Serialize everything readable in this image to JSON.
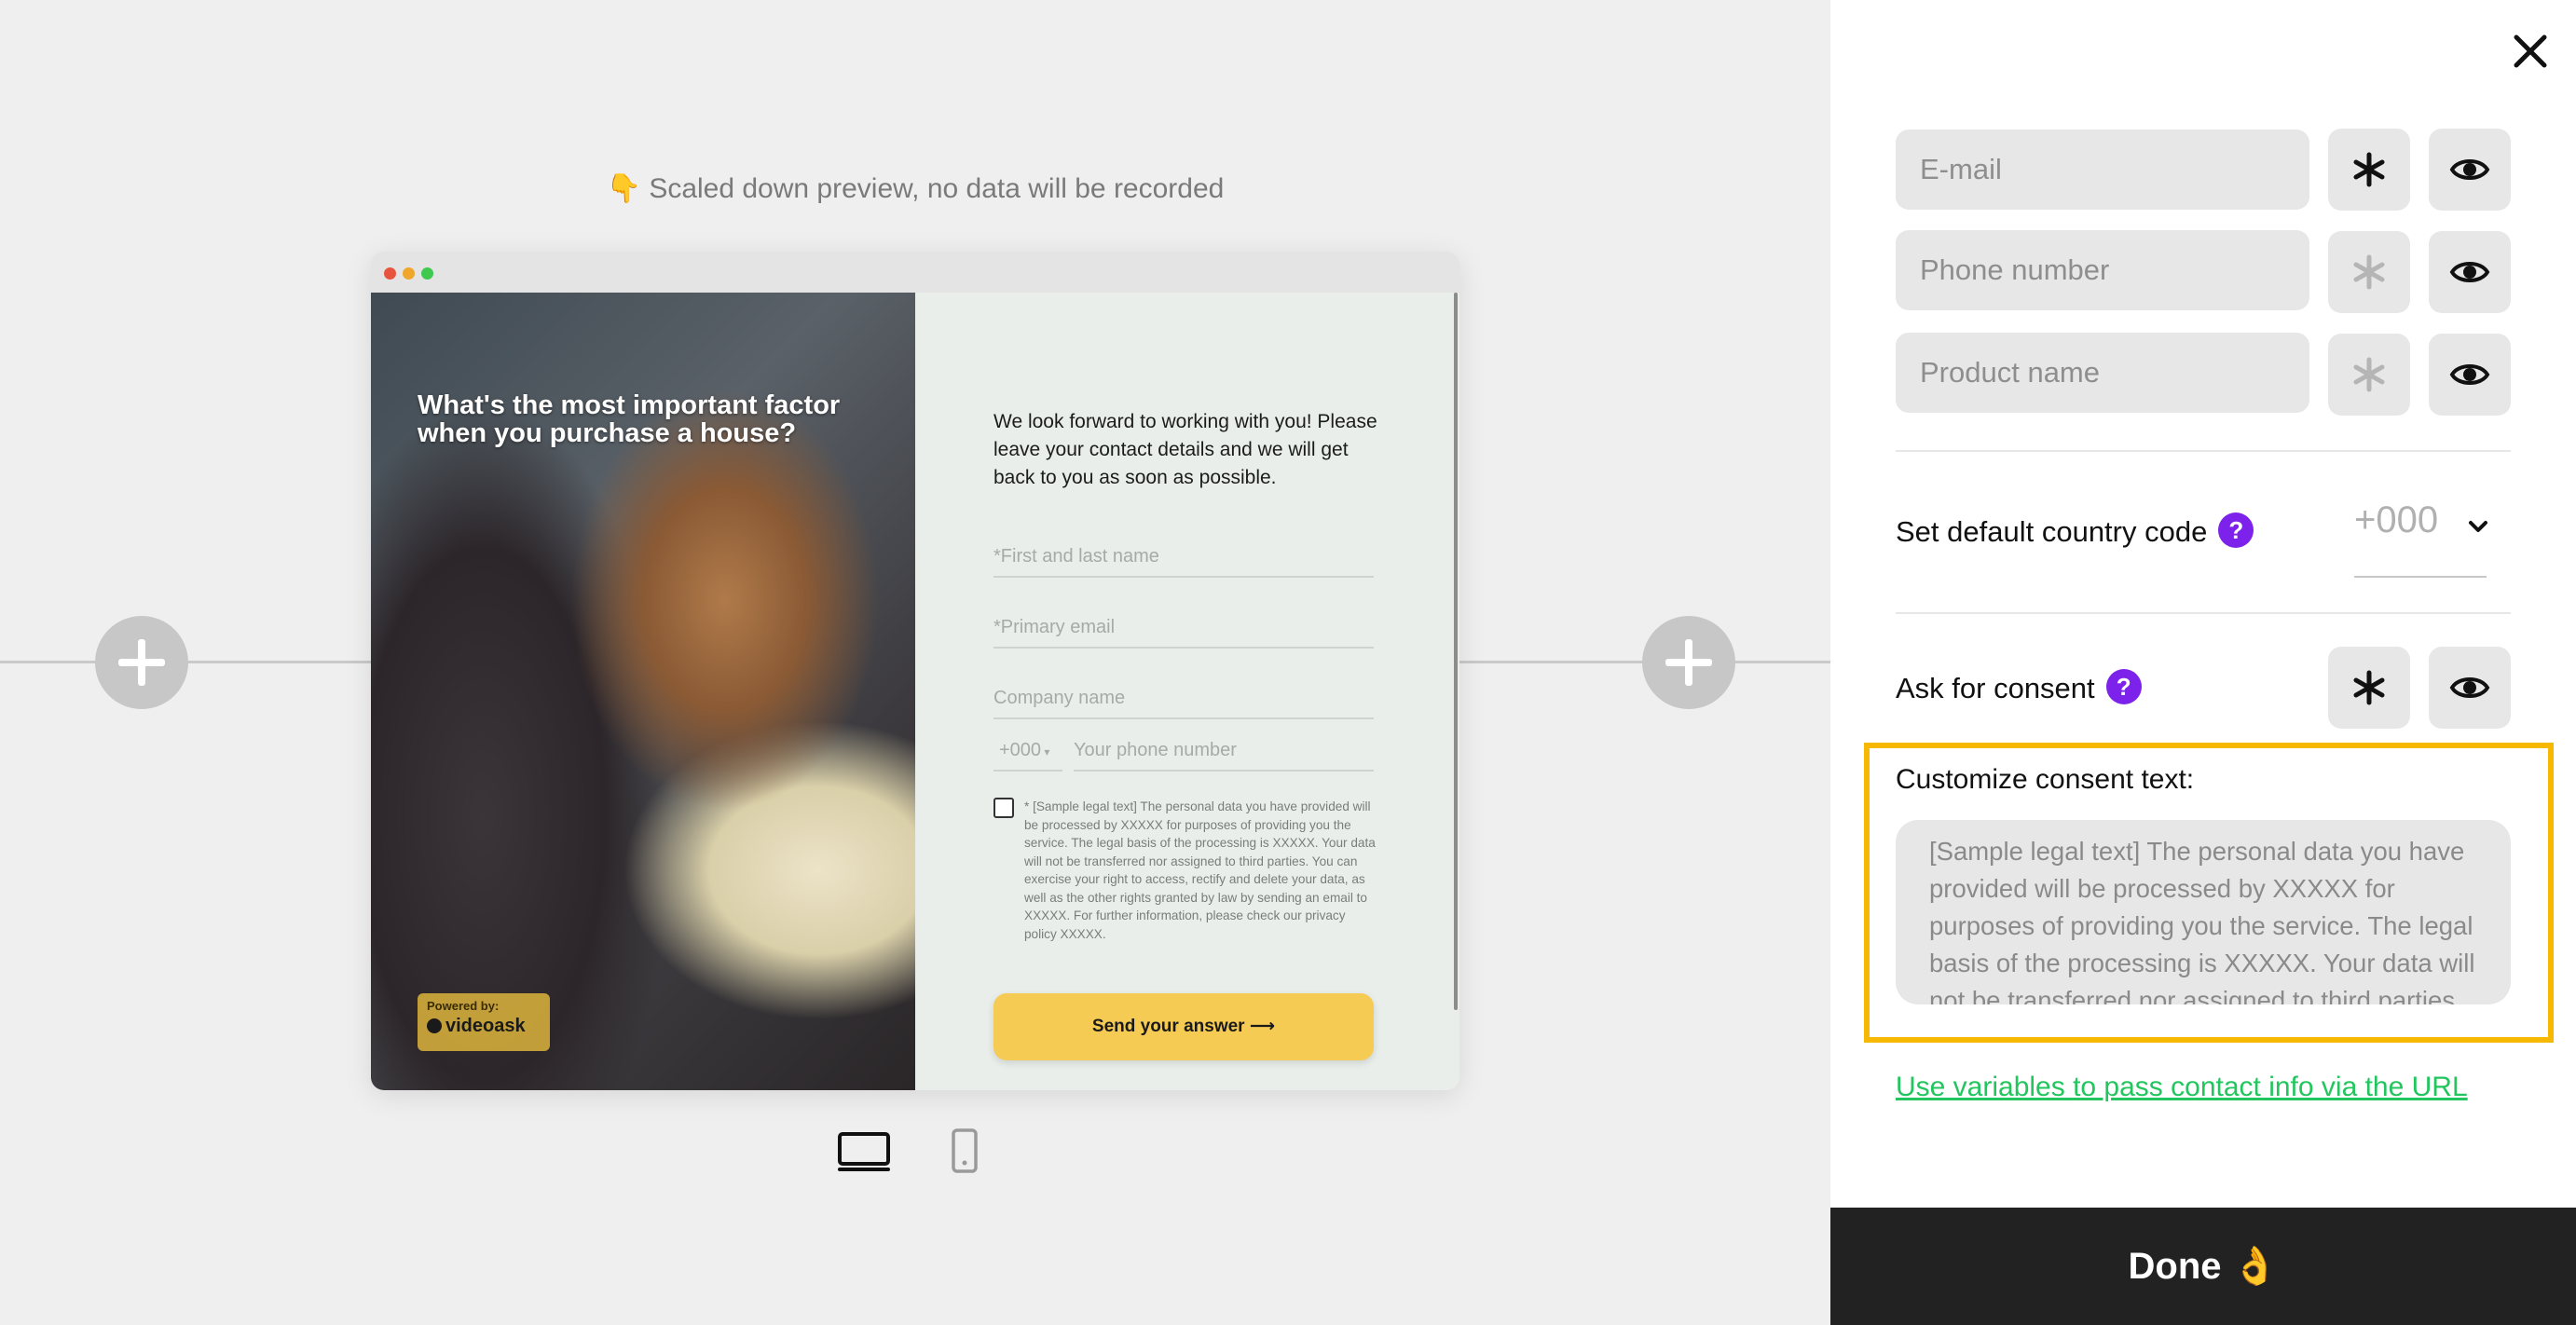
{
  "canvas": {
    "preview_note": "👇 Scaled down preview, no data will be recorded",
    "browser_dots": [
      "#e8553e",
      "#f0a62a",
      "#3fc94f"
    ]
  },
  "video": {
    "question": "What's the most important factor when you purchase a house?",
    "powered_label": "Powered by:",
    "powered_brand": "videoask"
  },
  "form": {
    "intro": "We look forward to working with you! Please leave your contact details and we will get back to you as soon as possible.",
    "fields": {
      "name": "*First and last name",
      "email": "*Primary email",
      "company": "Company name",
      "phone_code": "+000",
      "phone": "Your phone number"
    },
    "legal": "* [Sample legal text] The personal data you have provided will be processed by XXXXX for purposes of providing you the service. The legal basis of the processing is XXXXX. Your data will not be transferred nor assigned to third parties. You can exercise your right to access, rectify and delete your data, as well as the other rights granted by law by sending an email to XXXXX. For further information, please check our privacy policy XXXXX.",
    "submit": "Send your answer ⟶"
  },
  "panel": {
    "fields": [
      {
        "placeholder": "E-mail",
        "required": true,
        "visible": true
      },
      {
        "placeholder": "Phone number",
        "required": false,
        "visible": true
      },
      {
        "placeholder": "Product name",
        "required": false,
        "visible": true
      }
    ],
    "country_code_label": "Set default country code",
    "country_code_value": "+000",
    "consent_label": "Ask for consent",
    "help_glyph": "?",
    "consent_title": "Customize consent text:",
    "consent_text": "[Sample legal text] The personal data you have provided will be processed by XXXXX for purposes of providing you the service. The legal basis of the processing is XXXXX. Your data will not be transferred nor assigned to third parties. You can exercise your right to access, rectify and delete your data, as well as the other rights granted by law by sending an email to XXXXX. For further information, please check our privacy policy XXXXX.",
    "url_link": "Use variables to pass contact info via the URL",
    "done": "Done 👌"
  },
  "colors": {
    "accent_purple": "#7d22ea",
    "highlight": "#f6b800",
    "link_green": "#22c55e",
    "submit_yellow": "#f6cb54",
    "done_bg": "#222222"
  }
}
